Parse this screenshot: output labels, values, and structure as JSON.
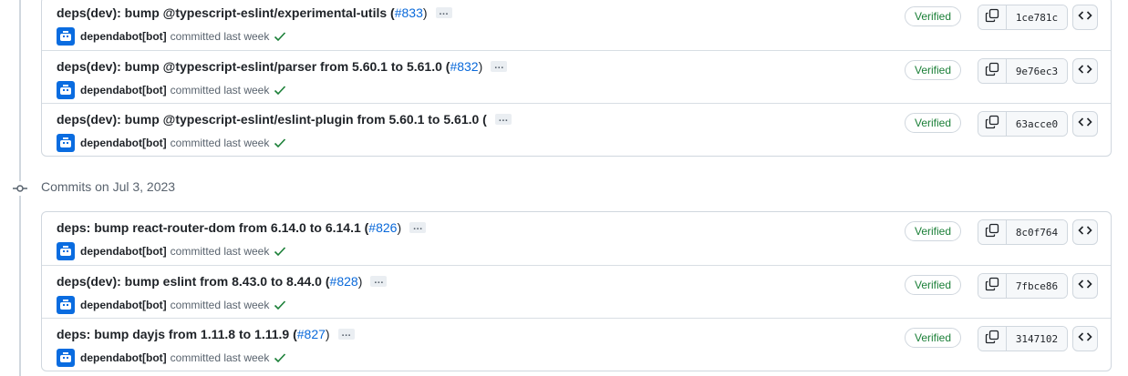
{
  "groups": [
    {
      "header": "",
      "commits": [
        {
          "message": "deps(dev): bump @typescript-eslint/experimental-utils (",
          "pr": "#833",
          "close": ")",
          "author": "dependabot[bot]",
          "meta": "committed last week",
          "verified": "Verified",
          "sha": "1ce781c"
        },
        {
          "message": "deps(dev): bump @typescript-eslint/parser from 5.60.1 to 5.61.0 (",
          "pr": "#832",
          "close": ")",
          "author": "dependabot[bot]",
          "meta": "committed last week",
          "verified": "Verified",
          "sha": "9e76ec3"
        },
        {
          "message": "deps(dev): bump @typescript-eslint/eslint-plugin from 5.60.1 to 5.61.0 (",
          "pr": "",
          "close": "",
          "author": "dependabot[bot]",
          "meta": "committed last week",
          "verified": "Verified",
          "sha": "63acce0"
        }
      ]
    },
    {
      "header": "Commits on Jul 3, 2023",
      "commits": [
        {
          "message": "deps: bump react-router-dom from 6.14.0 to 6.14.1 (",
          "pr": "#826",
          "close": ")",
          "author": "dependabot[bot]",
          "meta": "committed last week",
          "verified": "Verified",
          "sha": "8c0f764"
        },
        {
          "message": "deps(dev): bump eslint from 8.43.0 to 8.44.0 (",
          "pr": "#828",
          "close": ")",
          "author": "dependabot[bot]",
          "meta": "committed last week",
          "verified": "Verified",
          "sha": "7fbce86"
        },
        {
          "message": "deps: bump dayjs from 1.11.8 to 1.11.9 (",
          "pr": "#827",
          "close": ")",
          "author": "dependabot[bot]",
          "meta": "committed last week",
          "verified": "Verified",
          "sha": "3147102"
        }
      ]
    }
  ],
  "ellipsis": "…",
  "colors": {
    "link": "#0969da",
    "verified": "#1a7f37",
    "avatar": "#0a6ce0",
    "border": "#d0d7de"
  },
  "icons": {
    "copy": "copy-icon",
    "browse": "code-icon",
    "check": "check-icon",
    "commit": "git-commit-icon",
    "avatar": "dependabot-icon"
  }
}
